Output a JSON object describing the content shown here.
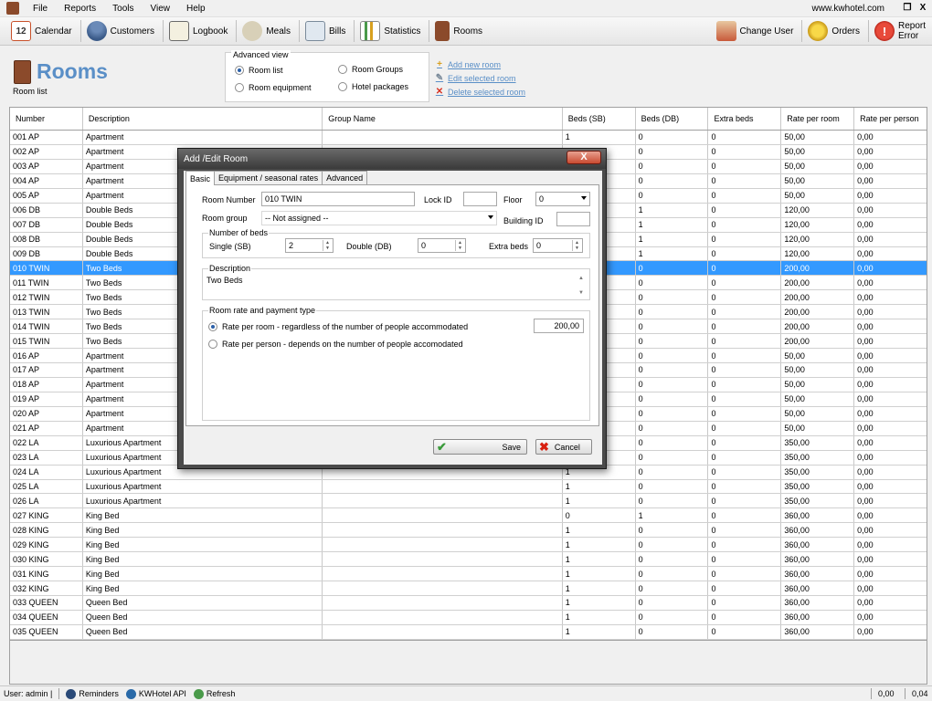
{
  "menu": {
    "items": [
      "File",
      "Reports",
      "Tools",
      "View",
      "Help"
    ],
    "url": "www.kwhotel.com",
    "restore": "❐",
    "close": "X"
  },
  "toolbar": {
    "calendar": "Calendar",
    "calendar_day": "12",
    "customers": "Customers",
    "logbook": "Logbook",
    "meals": "Meals",
    "bills": "Bills",
    "statistics": "Statistics",
    "rooms": "Rooms",
    "change_user": "Change User",
    "orders": "Orders",
    "report_error_1": "Report",
    "report_error_2": "Error"
  },
  "header": {
    "title": "Rooms",
    "subtitle": "Room list"
  },
  "advanced_view": {
    "title": "Advanced view",
    "room_list": "Room list",
    "room_equipment": "Room equipment",
    "room_groups": "Room Groups",
    "hotel_packages": "Hotel packages"
  },
  "actions": {
    "add": "Add new room",
    "edit": "Edit selected room",
    "delete": "Delete selected room"
  },
  "table": {
    "headers": {
      "number": "Number",
      "description": "Description",
      "group": "Group Name",
      "sb": "Beds (SB)",
      "db": "Beds (DB)",
      "extra": "Extra beds",
      "rate_room": "Rate per room",
      "rate_person": "Rate per person"
    },
    "rows": [
      [
        "001 AP",
        "Apartment",
        "",
        "1",
        "0",
        "0",
        "50,00",
        "0,00"
      ],
      [
        "002 AP",
        "Apartment",
        "",
        "",
        "0",
        "0",
        "50,00",
        "0,00"
      ],
      [
        "003 AP",
        "Apartment",
        "",
        "",
        "0",
        "0",
        "50,00",
        "0,00"
      ],
      [
        "004 AP",
        "Apartment",
        "",
        "",
        "0",
        "0",
        "50,00",
        "0,00"
      ],
      [
        "005 AP",
        "Apartment",
        "",
        "",
        "0",
        "0",
        "50,00",
        "0,00"
      ],
      [
        "006 DB",
        "Double Beds",
        "",
        "",
        "1",
        "0",
        "120,00",
        "0,00"
      ],
      [
        "007 DB",
        "Double Beds",
        "",
        "",
        "1",
        "0",
        "120,00",
        "0,00"
      ],
      [
        "008 DB",
        "Double Beds",
        "",
        "",
        "1",
        "0",
        "120,00",
        "0,00"
      ],
      [
        "009 DB",
        "Double Beds",
        "",
        "",
        "1",
        "0",
        "120,00",
        "0,00"
      ],
      [
        "010 TWIN",
        "Two Beds",
        "",
        "",
        "0",
        "0",
        "200,00",
        "0,00"
      ],
      [
        "011 TWIN",
        "Two Beds",
        "",
        "",
        "0",
        "0",
        "200,00",
        "0,00"
      ],
      [
        "012 TWIN",
        "Two Beds",
        "",
        "",
        "0",
        "0",
        "200,00",
        "0,00"
      ],
      [
        "013 TWIN",
        "Two Beds",
        "",
        "",
        "0",
        "0",
        "200,00",
        "0,00"
      ],
      [
        "014 TWIN",
        "Two Beds",
        "",
        "",
        "0",
        "0",
        "200,00",
        "0,00"
      ],
      [
        "015 TWIN",
        "Two Beds",
        "",
        "",
        "0",
        "0",
        "200,00",
        "0,00"
      ],
      [
        "016 AP",
        "Apartment",
        "",
        "",
        "0",
        "0",
        "50,00",
        "0,00"
      ],
      [
        "017 AP",
        "Apartment",
        "",
        "",
        "0",
        "0",
        "50,00",
        "0,00"
      ],
      [
        "018 AP",
        "Apartment",
        "",
        "",
        "0",
        "0",
        "50,00",
        "0,00"
      ],
      [
        "019 AP",
        "Apartment",
        "",
        "",
        "0",
        "0",
        "50,00",
        "0,00"
      ],
      [
        "020 AP",
        "Apartment",
        "",
        "",
        "0",
        "0",
        "50,00",
        "0,00"
      ],
      [
        "021 AP",
        "Apartment",
        "",
        "",
        "0",
        "0",
        "50,00",
        "0,00"
      ],
      [
        "022 LA",
        "Luxurious Apartment",
        "",
        "",
        "0",
        "0",
        "350,00",
        "0,00"
      ],
      [
        "023 LA",
        "Luxurious Apartment",
        "",
        "",
        "0",
        "0",
        "350,00",
        "0,00"
      ],
      [
        "024 LA",
        "Luxurious Apartment",
        "",
        "1",
        "0",
        "0",
        "350,00",
        "0,00"
      ],
      [
        "025 LA",
        "Luxurious Apartment",
        "",
        "1",
        "0",
        "0",
        "350,00",
        "0,00"
      ],
      [
        "026 LA",
        "Luxurious Apartment",
        "",
        "1",
        "0",
        "0",
        "350,00",
        "0,00"
      ],
      [
        "027 KING",
        "King Bed",
        "",
        "0",
        "1",
        "0",
        "360,00",
        "0,00"
      ],
      [
        "028 KING",
        "King Bed",
        "",
        "1",
        "0",
        "0",
        "360,00",
        "0,00"
      ],
      [
        "029 KING",
        "King Bed",
        "",
        "1",
        "0",
        "0",
        "360,00",
        "0,00"
      ],
      [
        "030 KING",
        "King Bed",
        "",
        "1",
        "0",
        "0",
        "360,00",
        "0,00"
      ],
      [
        "031 KING",
        "King Bed",
        "",
        "1",
        "0",
        "0",
        "360,00",
        "0,00"
      ],
      [
        "032 KING",
        "King Bed",
        "",
        "1",
        "0",
        "0",
        "360,00",
        "0,00"
      ],
      [
        "033 QUEEN",
        "Queen Bed",
        "",
        "1",
        "0",
        "0",
        "360,00",
        "0,00"
      ],
      [
        "034 QUEEN",
        "Queen Bed",
        "",
        "1",
        "0",
        "0",
        "360,00",
        "0,00"
      ],
      [
        "035 QUEEN",
        "Queen Bed",
        "",
        "1",
        "0",
        "0",
        "360,00",
        "0,00"
      ]
    ],
    "selected_row": 9
  },
  "dialog": {
    "title": "Add /Edit Room",
    "close": "X",
    "tabs": [
      "Basic",
      "Equipment / seasonal rates",
      "Advanced"
    ],
    "room_number_label": "Room Number",
    "room_number_value": "010 TWIN",
    "lock_id_label": "Lock ID",
    "lock_id_value": "",
    "floor_label": "Floor",
    "floor_value": "0",
    "room_group_label": "Room group",
    "room_group_value": "-- Not assigned --",
    "building_id_label": "Building ID",
    "building_id_value": "",
    "beds_group_title": "Number of beds",
    "single_label": "Single (SB)",
    "single_value": "2",
    "double_label": "Double (DB)",
    "double_value": "0",
    "extra_label": "Extra beds",
    "extra_value": "0",
    "description_title": "Description",
    "description_value": "Two Beds",
    "rate_group_title": "Room rate and payment type",
    "rate_per_room_label": "Rate per room - regardless of the number of people accommodated",
    "rate_per_room_value": "200,00",
    "rate_per_person_label": "Rate per person - depends on the number of people accomodated",
    "save": "Save",
    "cancel": "Cancel"
  },
  "statusbar": {
    "user": "User: admin |",
    "reminders": "Reminders",
    "api": "KWHotel API",
    "refresh": "Refresh",
    "value1": "0,00",
    "value2": "0,04"
  },
  "colors": {
    "title_blue": "#5a8fc7",
    "selection": "#3399ff",
    "link": "#5a8fc7"
  }
}
